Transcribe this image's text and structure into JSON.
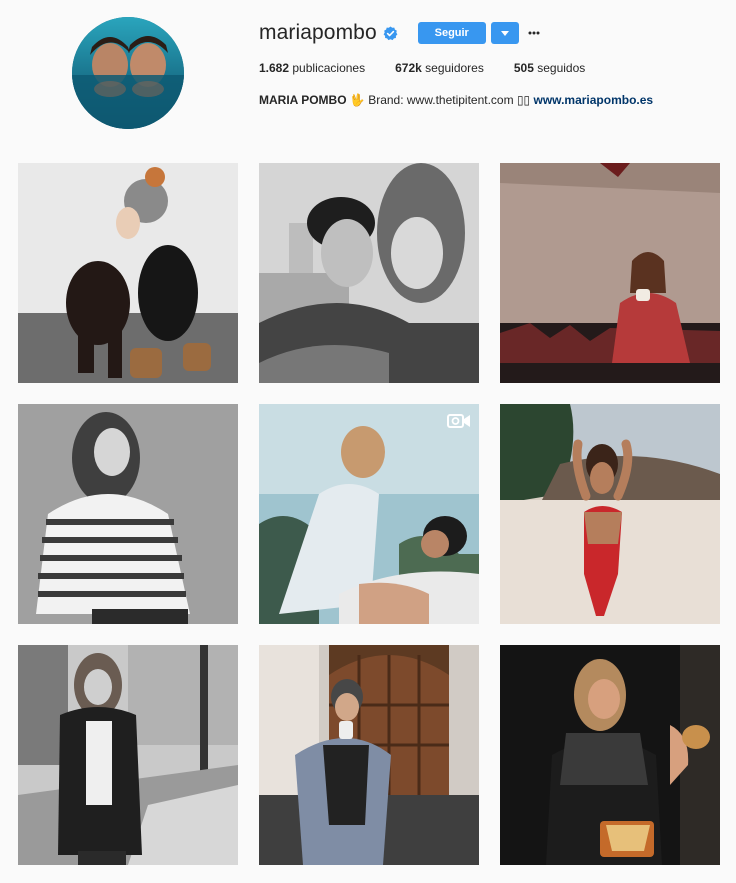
{
  "profile": {
    "username": "mariapombo",
    "follow_label": "Seguir",
    "stats": {
      "posts_count": "1.682",
      "posts_label": "publicaciones",
      "followers_count": "672k",
      "followers_label": "seguidores",
      "following_count": "505",
      "following_label": "seguidos"
    },
    "bio": {
      "name": "MARIA POMBO",
      "text": "Brand: www.thetipitent.com",
      "emoji_placeholder": "▯▯",
      "link": "www.mariapombo.es"
    }
  },
  "colors": {
    "accent": "#3897f0",
    "link": "#003569",
    "background": "#fafafa"
  },
  "icons": {
    "verified": "verified-badge-icon",
    "dropdown": "chevron-down-icon",
    "more": "more-options-icon",
    "video": "video-camera-icon"
  }
}
